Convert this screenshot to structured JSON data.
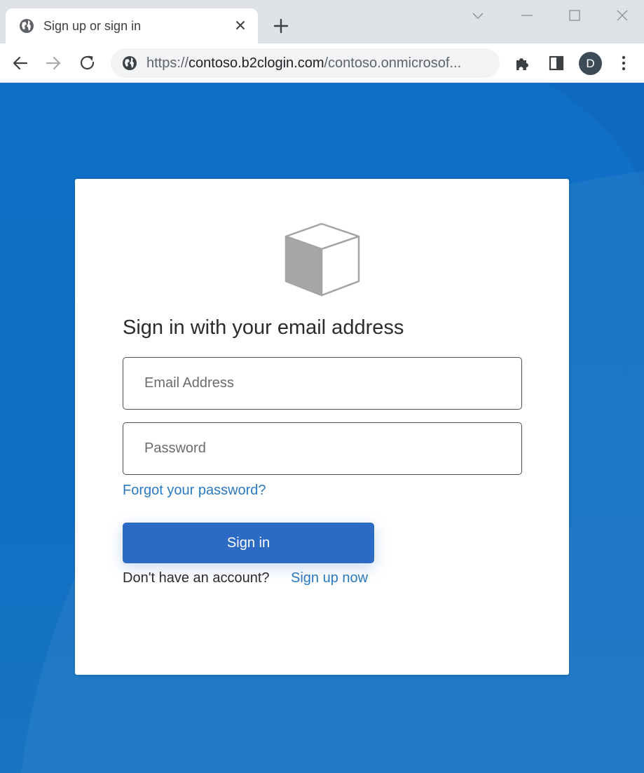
{
  "browser": {
    "tab_title": "Sign up or sign in",
    "url_scheme": "https://",
    "url_host": "contoso.b2clogin.com",
    "url_path": "/contoso.onmicrosof...",
    "profile_initial": "D"
  },
  "form": {
    "heading": "Sign in with your email address",
    "email_placeholder": "Email Address",
    "password_placeholder": "Password",
    "forgot_link": "Forgot your password?",
    "signin_button": "Sign in",
    "no_account_text": "Don't have an account?",
    "signup_link": "Sign up now"
  },
  "colors": {
    "page_background": "#0f6fc6",
    "button_primary": "#2b6ac5",
    "link": "#2a79c0"
  }
}
